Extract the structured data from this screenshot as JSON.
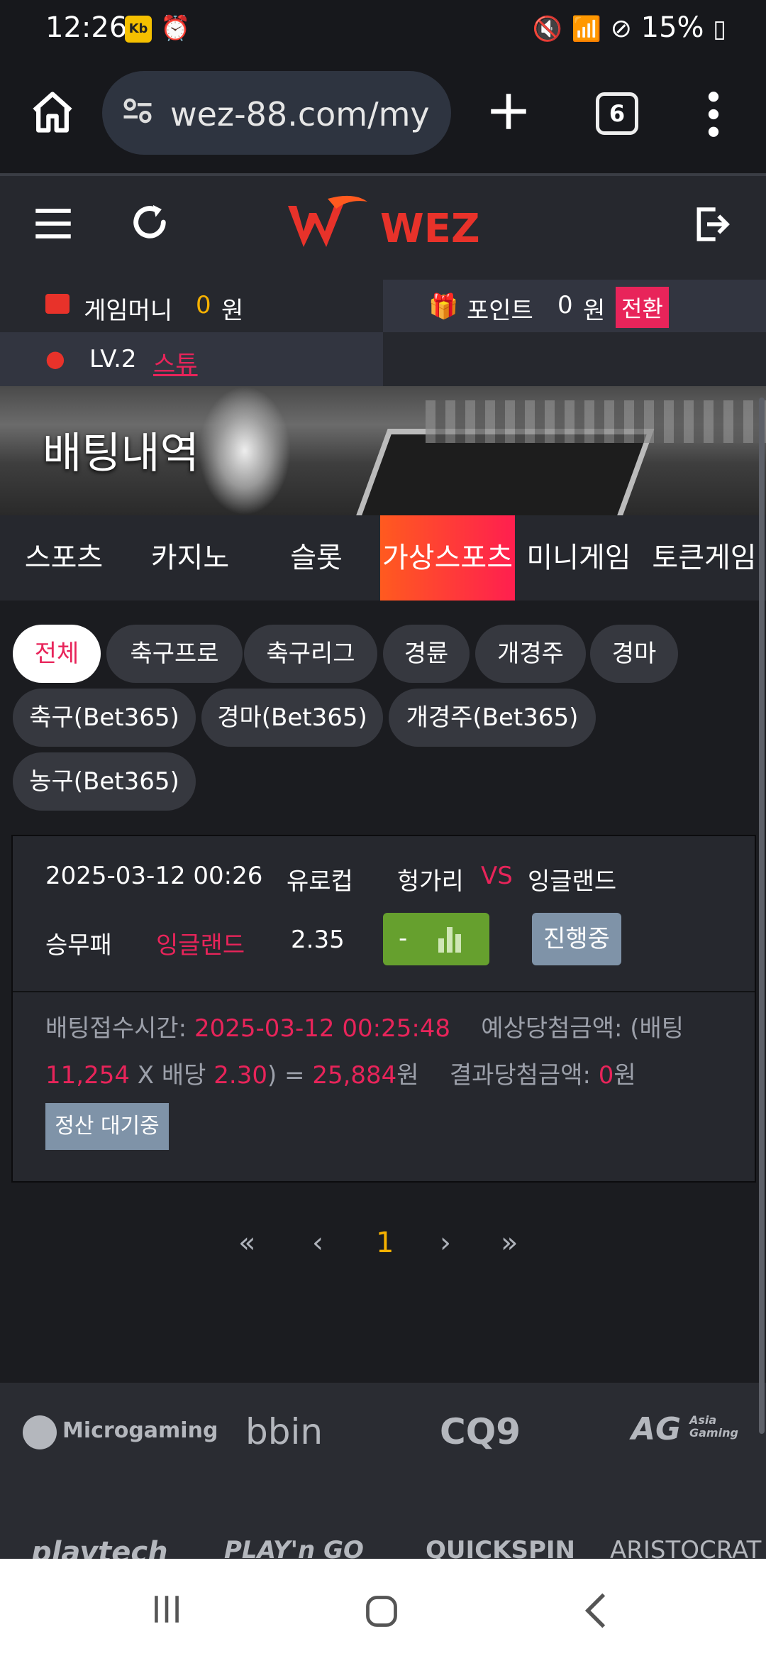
{
  "status_bar": {
    "time": "12:26",
    "notif_badge": "Kb",
    "battery": "15%"
  },
  "browser": {
    "url": "wez-88.com/my",
    "tab_count": "6"
  },
  "site": {
    "logo_text": "WEZ"
  },
  "account": {
    "game_money_label": "게임머니",
    "game_money_value": "0",
    "game_money_unit": "원",
    "point_label": "포인트",
    "point_value": "0",
    "point_unit": "원",
    "convert_label": "전환",
    "level": "LV.2",
    "level_user": "스튜"
  },
  "banner": {
    "title": "배팅내역"
  },
  "category_tabs": [
    {
      "label": "스포츠"
    },
    {
      "label": "카지노"
    },
    {
      "label": "슬롯"
    },
    {
      "label": "가상스포츠",
      "active": true
    },
    {
      "label": "미니게임"
    },
    {
      "label": "토큰게임"
    }
  ],
  "filter_chips": [
    {
      "label": "전체",
      "active": true
    },
    {
      "label": "축구프로"
    },
    {
      "label": "축구리그"
    },
    {
      "label": "경륜"
    },
    {
      "label": "개경주"
    },
    {
      "label": "경마"
    },
    {
      "label": "축구(Bet365)"
    },
    {
      "label": "경마(Bet365)"
    },
    {
      "label": "개경주(Bet365)"
    },
    {
      "label": "농구(Bet365)"
    }
  ],
  "bet": {
    "datetime": "2025-03-12 00:26",
    "league": "유로컵",
    "home": "헝가리",
    "vs": "VS",
    "away": "잉글랜드",
    "market": "승무패",
    "pick": "잉글랜드",
    "odds": "2.35",
    "odds_btn": "-",
    "status": "진행중",
    "detail": {
      "time_label": "배팅접수시간: ",
      "time_value": "2025-03-12 00:25:48",
      "expected_label": "예상당첨금액: (배팅 ",
      "stake": "11,254",
      "x": " X 배당 ",
      "mult": "2.30",
      "eq": ") = ",
      "payout": "25,884",
      "won": "원",
      "result_label": "결과당첨금액: ",
      "result_value": "0",
      "result_unit": "원"
    },
    "settle_label": "정산 대기중"
  },
  "pagination": {
    "first": "«",
    "prev": "‹",
    "current": "1",
    "next": "›",
    "last": "»"
  },
  "providers": [
    "Microgaming",
    "bbin",
    "CQ9",
    "AG",
    "Asia Gaming",
    "playtech",
    "PLAY'n GO",
    "QUICKSPIN",
    "ARISTOCRAT"
  ],
  "colors": {
    "accent": "#e8245a",
    "money": "#f6b100",
    "odds_green": "#66a02e",
    "status_gray": "#7f93a8"
  }
}
